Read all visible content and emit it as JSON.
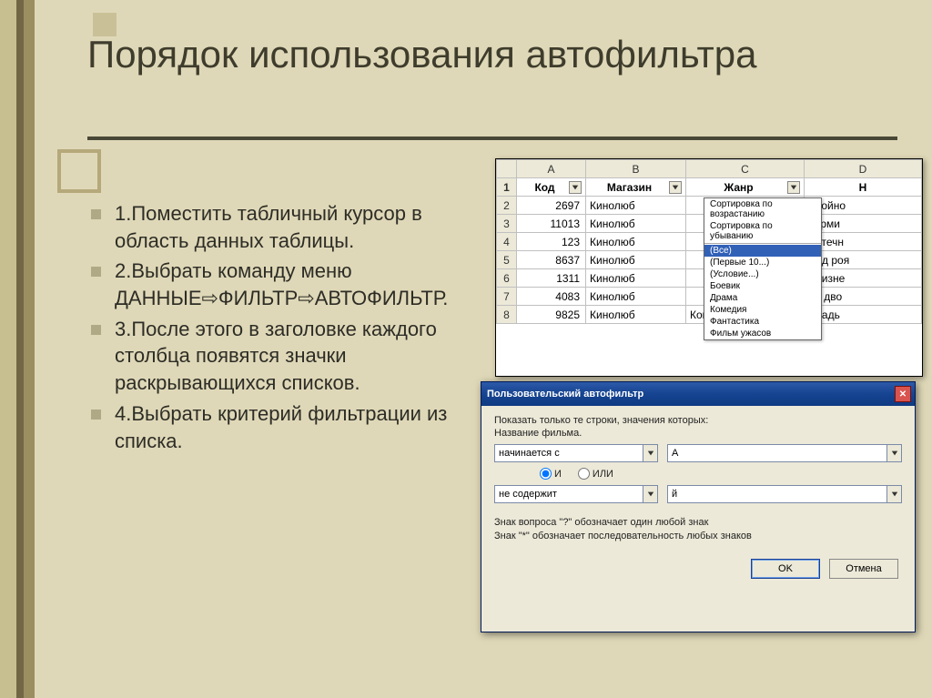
{
  "title": "Порядок использования автофильтра",
  "bullets": [
    "1.Поместить табличный курсор в область данных таблицы.",
    "2.Выбрать команду меню ДАННЫЕ⇨ФИЛЬТР⇨АВТОФИЛЬТР.",
    "3.После этого в заголовке каждого столбца появятся значки раскрывающихся списков.",
    "4.Выбрать критерий фильтрации из списка."
  ],
  "excel": {
    "columns": [
      "",
      "A",
      "B",
      "C",
      "D"
    ],
    "headers": [
      "Код",
      "Магазин",
      "Жанр",
      "Н"
    ],
    "rows": [
      {
        "n": "2",
        "code": "2697",
        "store": "Кинолюб",
        "genre": "",
        "name": "Двойно"
      },
      {
        "n": "3",
        "code": "11013",
        "store": "Кинолюб",
        "genre": "",
        "name": "Терми"
      },
      {
        "n": "4",
        "code": "123",
        "store": "Кинолюб",
        "genre": "",
        "name": "Аптечн"
      },
      {
        "n": "5",
        "code": "8637",
        "store": "Кинолюб",
        "genre": "",
        "name": "Под роя"
      },
      {
        "n": "6",
        "code": "1311",
        "store": "Кинолюб",
        "genre": "",
        "name": "Близне"
      },
      {
        "n": "7",
        "code": "4083",
        "store": "Кинолюб",
        "genre": "",
        "name": "За дво"
      },
      {
        "n": "8",
        "code": "9825",
        "store": "Кинолюб",
        "genre": "Комедия",
        "name": "Свадь"
      }
    ],
    "dropdown": [
      "Сортировка по возрастанию",
      "Сортировка по убыванию",
      "(Все)",
      "(Первые 10...)",
      "(Условие...)",
      "Боевик",
      "Драма",
      "Комедия",
      "Фантастика",
      "Фильм ужасов"
    ],
    "dropdown_selected_index": 2
  },
  "dialog": {
    "title": "Пользовательский автофильтр",
    "prompt": "Показать только те строки, значения которых:",
    "field_label": "Название фильма.",
    "op1": "начинается с",
    "val1": "А",
    "radio_and": "И",
    "radio_or": "ИЛИ",
    "op2": "не содержит",
    "val2": "й",
    "hint1": "Знак вопроса \"?\" обозначает один любой знак",
    "hint2": "Знак \"*\" обозначает последовательность любых знаков",
    "ok": "OK",
    "cancel": "Отмена"
  }
}
